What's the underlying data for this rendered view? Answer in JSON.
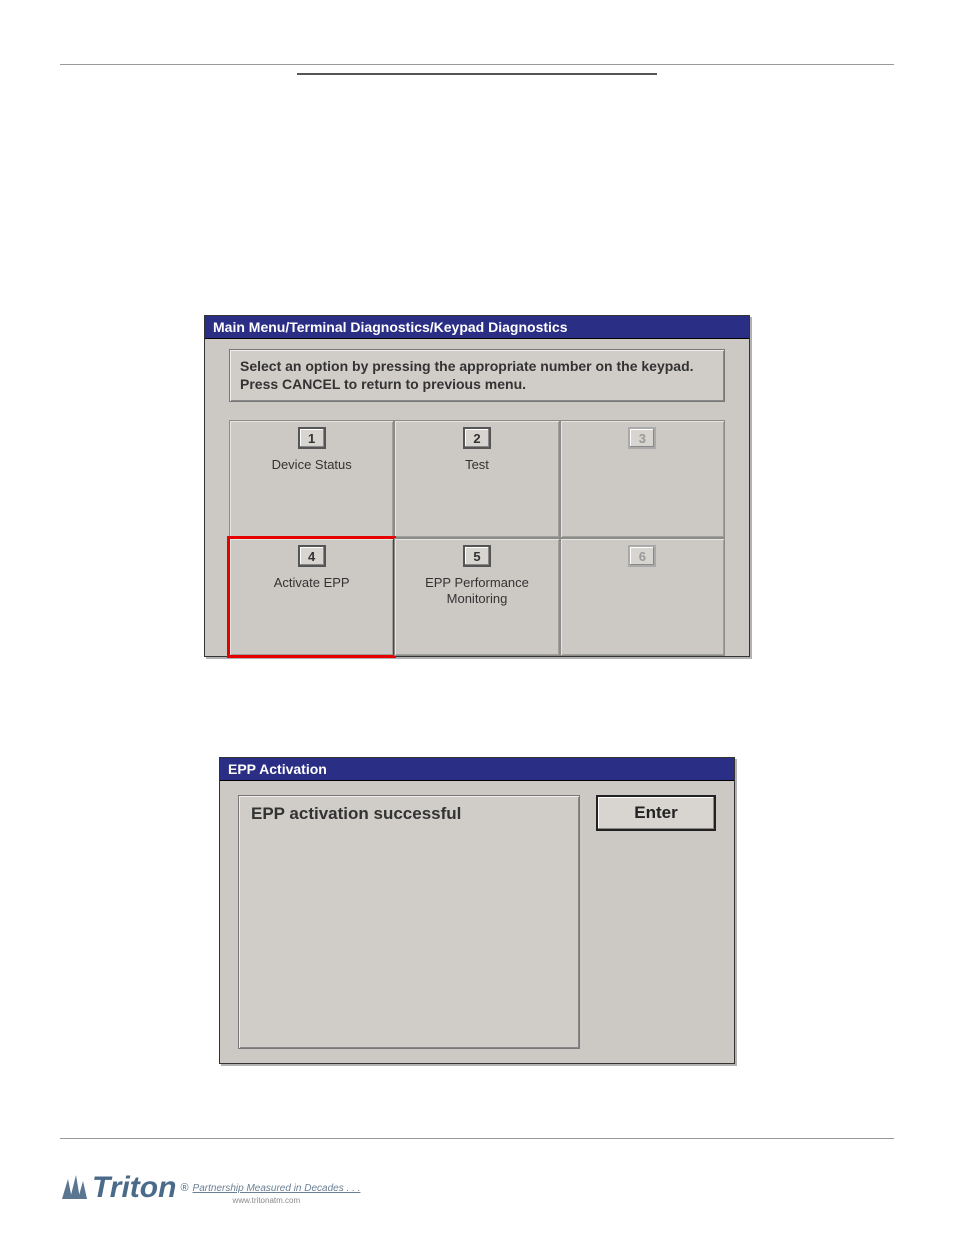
{
  "window1": {
    "title": "Main Menu/Terminal Diagnostics/Keypad Diagnostics",
    "instruction": "Select an option by pressing the appropriate number on the keypad.  Press CANCEL to return to previous menu.",
    "cells": [
      {
        "num": "1",
        "label": "Device Status",
        "disabled": false,
        "highlight": false
      },
      {
        "num": "2",
        "label": "Test",
        "disabled": false,
        "highlight": false
      },
      {
        "num": "3",
        "label": "",
        "disabled": true,
        "highlight": false
      },
      {
        "num": "4",
        "label": "Activate EPP",
        "disabled": false,
        "highlight": true
      },
      {
        "num": "5",
        "label": "EPP Performance Monitoring",
        "disabled": false,
        "highlight": false
      },
      {
        "num": "6",
        "label": "",
        "disabled": true,
        "highlight": false
      }
    ]
  },
  "window2": {
    "title": "EPP Activation",
    "result": "EPP activation successful",
    "enter": "Enter"
  },
  "footer": {
    "brand": "Triton",
    "reg": "®",
    "tagline": "Partnership Measured in Decades . . .",
    "url": "www.tritonatm.com"
  }
}
